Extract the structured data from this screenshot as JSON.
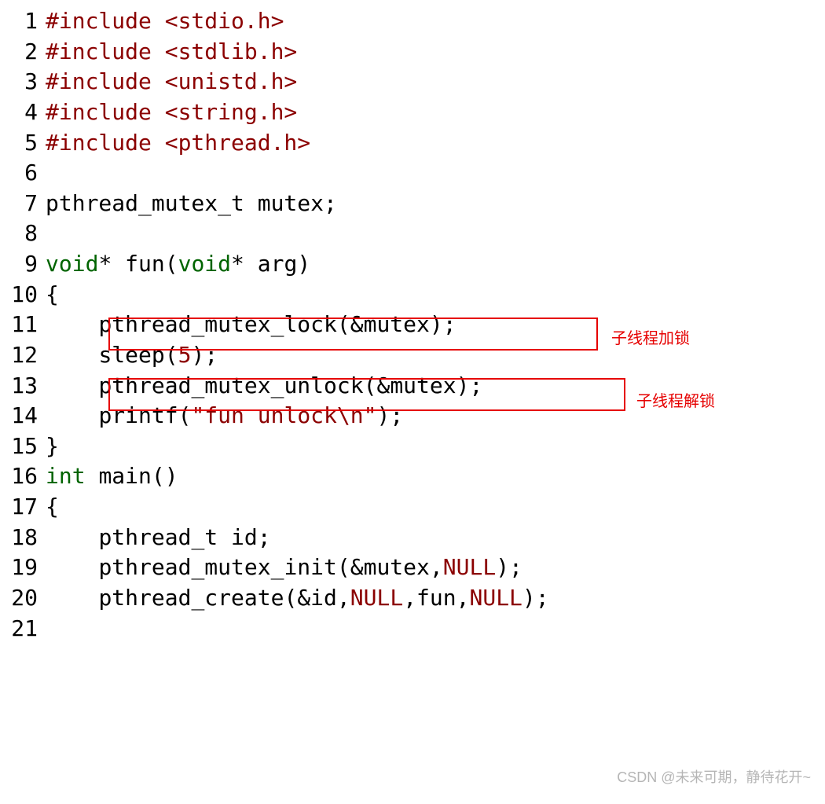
{
  "code": {
    "lines": [
      {
        "n": "1",
        "tokens": [
          [
            "pp",
            "#include"
          ],
          [
            "sp",
            " "
          ],
          [
            "str",
            "<stdio.h>"
          ]
        ]
      },
      {
        "n": "2",
        "tokens": [
          [
            "pp",
            "#include"
          ],
          [
            "sp",
            " "
          ],
          [
            "str",
            "<stdlib.h>"
          ]
        ]
      },
      {
        "n": "3",
        "tokens": [
          [
            "pp",
            "#include"
          ],
          [
            "sp",
            " "
          ],
          [
            "str",
            "<unistd.h>"
          ]
        ]
      },
      {
        "n": "4",
        "tokens": [
          [
            "pp",
            "#include"
          ],
          [
            "sp",
            " "
          ],
          [
            "str",
            "<string.h>"
          ]
        ]
      },
      {
        "n": "5",
        "tokens": [
          [
            "pp",
            "#include"
          ],
          [
            "sp",
            " "
          ],
          [
            "str",
            "<pthread.h>"
          ]
        ]
      },
      {
        "n": "6",
        "tokens": []
      },
      {
        "n": "7",
        "tokens": [
          [
            "id",
            "pthread_mutex_t mutex"
          ],
          [
            "punc",
            ";"
          ]
        ]
      },
      {
        "n": "8",
        "tokens": []
      },
      {
        "n": "9",
        "tokens": [
          [
            "kw",
            "void"
          ],
          [
            "punc",
            "* "
          ],
          [
            "id",
            "fun"
          ],
          [
            "punc",
            "("
          ],
          [
            "kw",
            "void"
          ],
          [
            "punc",
            "* "
          ],
          [
            "id",
            "arg"
          ],
          [
            "punc",
            ")"
          ]
        ]
      },
      {
        "n": "10",
        "tokens": [
          [
            "punc",
            "{"
          ]
        ]
      },
      {
        "n": "11",
        "tokens": [
          [
            "sp",
            "    "
          ],
          [
            "id",
            "pthread_mutex_lock"
          ],
          [
            "punc",
            "("
          ],
          [
            "punc",
            "&"
          ],
          [
            "id",
            "mutex"
          ],
          [
            "punc",
            ")"
          ],
          [
            "punc",
            ";"
          ]
        ]
      },
      {
        "n": "12",
        "tokens": [
          [
            "sp",
            "    "
          ],
          [
            "id",
            "sleep"
          ],
          [
            "punc",
            "("
          ],
          [
            "num",
            "5"
          ],
          [
            "punc",
            ")"
          ],
          [
            "punc",
            ";"
          ]
        ]
      },
      {
        "n": "13",
        "tokens": [
          [
            "sp",
            "    "
          ],
          [
            "id",
            "pthread_mutex_unlock"
          ],
          [
            "punc",
            "("
          ],
          [
            "punc",
            "&"
          ],
          [
            "id",
            "mutex"
          ],
          [
            "punc",
            ")"
          ],
          [
            "punc",
            ";"
          ]
        ]
      },
      {
        "n": "14",
        "tokens": [
          [
            "sp",
            "    "
          ],
          [
            "id",
            "printf"
          ],
          [
            "punc",
            "("
          ],
          [
            "str",
            "\"fun unlock"
          ],
          [
            "esc",
            "\\n"
          ],
          [
            "str",
            "\""
          ],
          [
            "punc",
            ")"
          ],
          [
            "punc",
            ";"
          ]
        ]
      },
      {
        "n": "15",
        "tokens": [
          [
            "punc",
            "}"
          ]
        ]
      },
      {
        "n": "16",
        "tokens": [
          [
            "kw",
            "int"
          ],
          [
            "sp",
            " "
          ],
          [
            "id",
            "main"
          ],
          [
            "punc",
            "()"
          ]
        ]
      },
      {
        "n": "17",
        "tokens": [
          [
            "punc",
            "{"
          ]
        ]
      },
      {
        "n": "18",
        "tokens": [
          [
            "sp",
            "    "
          ],
          [
            "id",
            "pthread_t id"
          ],
          [
            "punc",
            ";"
          ]
        ]
      },
      {
        "n": "19",
        "tokens": [
          [
            "sp",
            "    "
          ],
          [
            "id",
            "pthread_mutex_init"
          ],
          [
            "punc",
            "("
          ],
          [
            "punc",
            "&"
          ],
          [
            "id",
            "mutex"
          ],
          [
            "punc",
            ","
          ],
          [
            "null",
            "NULL"
          ],
          [
            "punc",
            ")"
          ],
          [
            "punc",
            ";"
          ]
        ]
      },
      {
        "n": "20",
        "tokens": [
          [
            "sp",
            "    "
          ],
          [
            "id",
            "pthread_create"
          ],
          [
            "punc",
            "("
          ],
          [
            "punc",
            "&"
          ],
          [
            "id",
            "id"
          ],
          [
            "punc",
            ","
          ],
          [
            "null",
            "NULL"
          ],
          [
            "punc",
            ","
          ],
          [
            "id",
            "fun"
          ],
          [
            "punc",
            ","
          ],
          [
            "null",
            "NULL"
          ],
          [
            "punc",
            ")"
          ],
          [
            "punc",
            ";"
          ]
        ]
      },
      {
        "n": "21",
        "tokens": []
      }
    ]
  },
  "annotations": {
    "box1": {
      "label": "子线程加锁"
    },
    "box2": {
      "label": "子线程解锁"
    }
  },
  "watermark": "CSDN @未来可期，静待花开~"
}
